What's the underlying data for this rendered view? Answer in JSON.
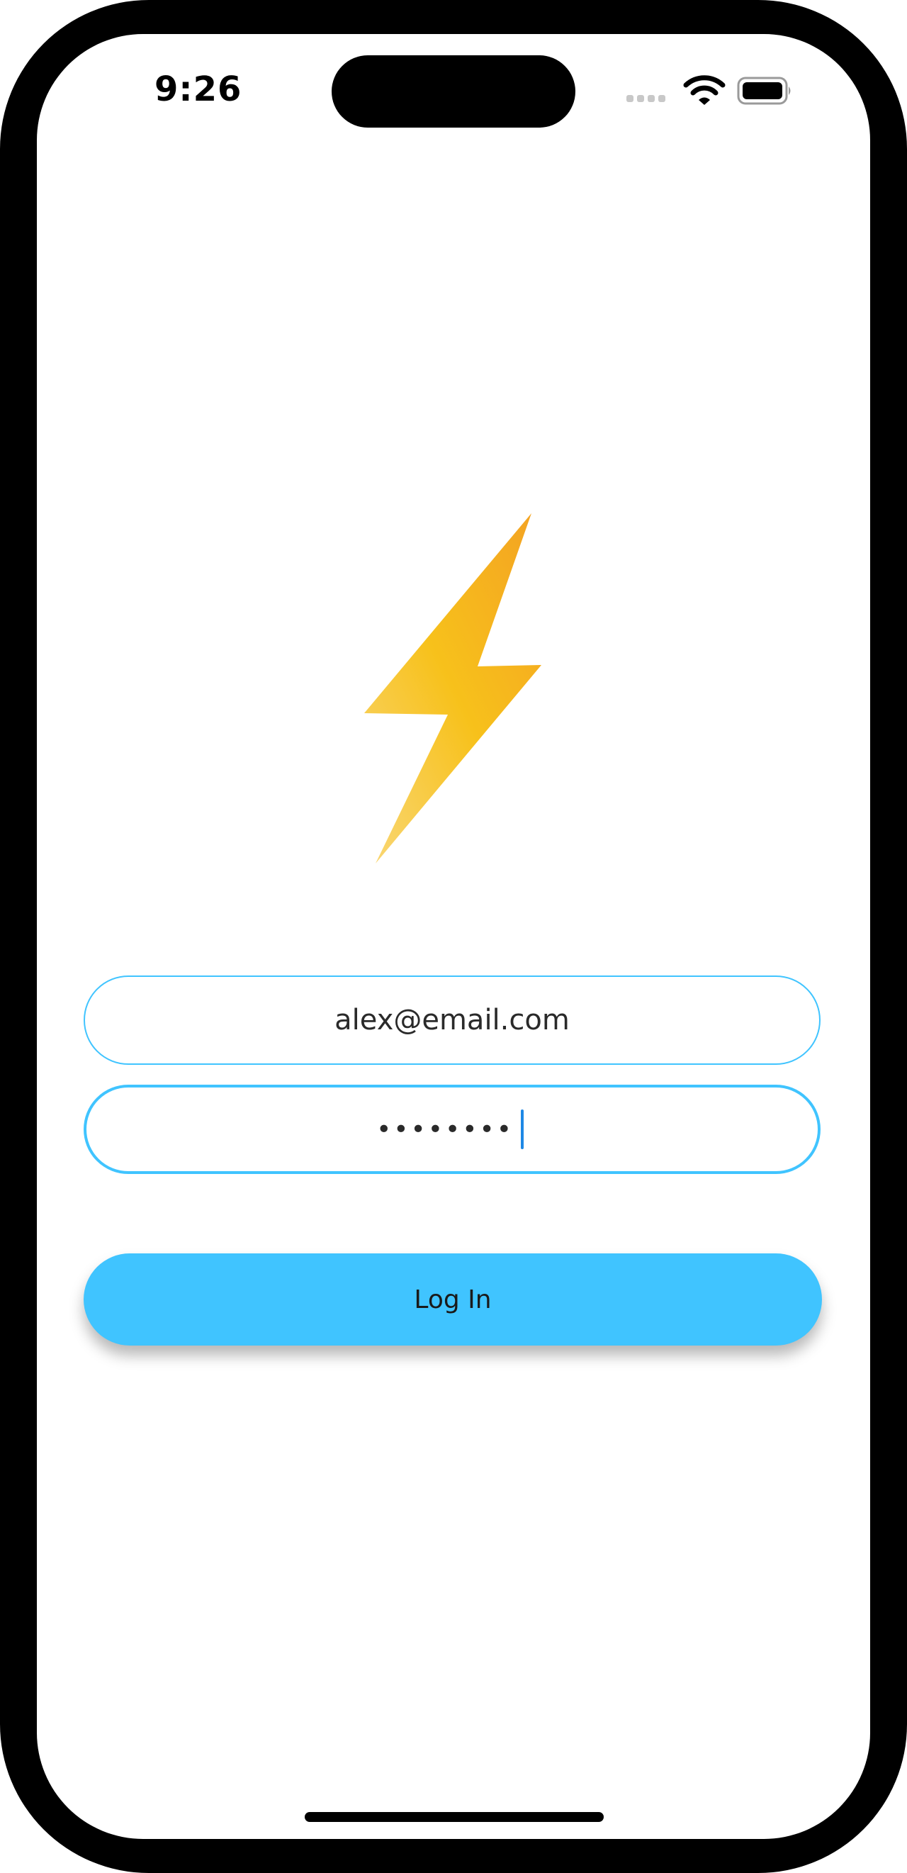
{
  "status_bar": {
    "time": "9:26",
    "icons": [
      "cellular-signal-icon",
      "wifi-icon",
      "battery-icon"
    ]
  },
  "logo": {
    "icon": "lightning-bolt-icon",
    "colors": [
      "#F4A522",
      "#F7C11B",
      "#F9D56E"
    ]
  },
  "form": {
    "email_value": "alex@email.com",
    "password_masked": "••••••••",
    "login_label": "Log In"
  },
  "colors": {
    "accent": "#40C4FF",
    "caret": "#1E88E5",
    "frame": "#000000",
    "background": "#FFFFFF"
  }
}
